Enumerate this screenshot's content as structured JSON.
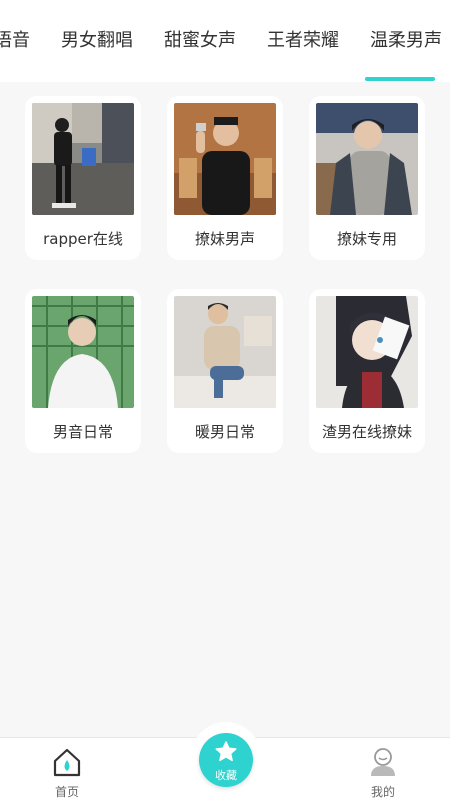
{
  "tabs": [
    {
      "label": "语音"
    },
    {
      "label": "男女翻唱"
    },
    {
      "label": "甜蜜女声"
    },
    {
      "label": "王者荣耀"
    },
    {
      "label": "温柔男声"
    }
  ],
  "active_tab_index": 4,
  "accent_color": "#2ed3cf",
  "cards": [
    {
      "label": "rapper在线"
    },
    {
      "label": "撩妹男声"
    },
    {
      "label": "撩妹专用"
    },
    {
      "label": "男音日常"
    },
    {
      "label": "暖男日常"
    },
    {
      "label": "渣男在线撩妹"
    }
  ],
  "bottom_nav": {
    "home": {
      "label": "首页",
      "icon": "home-icon"
    },
    "favorites": {
      "label": "收藏",
      "icon": "star-icon"
    },
    "mine": {
      "label": "我的",
      "icon": "user-icon"
    }
  }
}
